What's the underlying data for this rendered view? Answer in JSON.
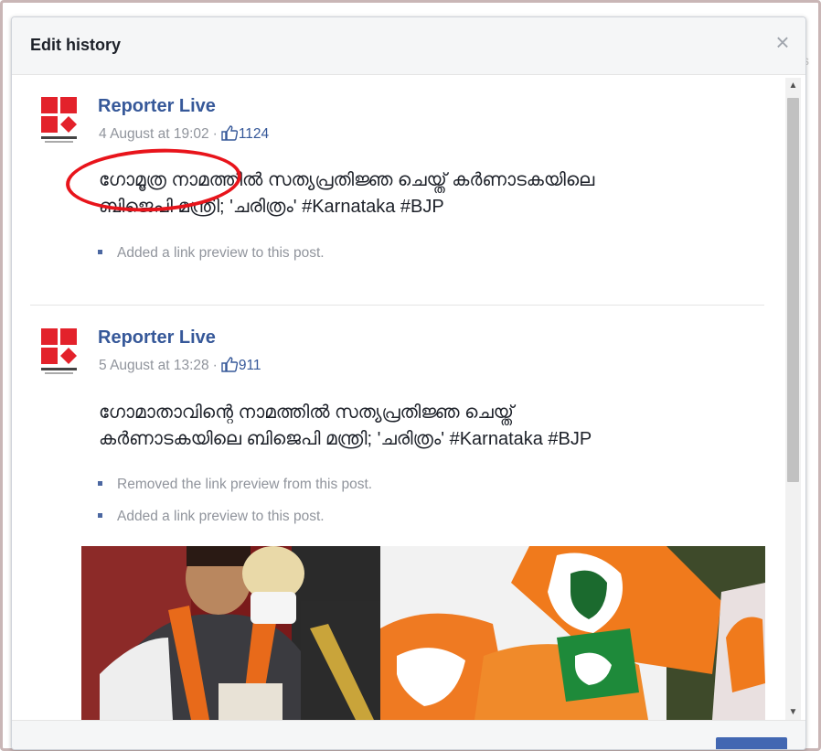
{
  "dialog": {
    "title": "Edit history",
    "close_glyph": "×"
  },
  "entries": [
    {
      "page_name": "Reporter Live",
      "timestamp": "4 August at 19:02",
      "likes": "1124",
      "text_line1": "ഗോമൂത്ര നാമത്തിൽ സത്യപ്രതിജ്ഞ ചെയ്ത് കർണാടകയിലെ",
      "text_line2": "ബിജെപി മന്ത്രി; 'ചരിത്രം' #Karnataka #BJP",
      "changes": [
        "Added a link preview to this post."
      ]
    },
    {
      "page_name": "Reporter Live",
      "timestamp": "5 August at 13:28",
      "likes": "911",
      "text_line1": "ഗോമാതാവിന്റെ നാമത്തിൽ സത്യപ്രതിജ്ഞ ചെയ്ത്",
      "text_line2": "കർണാടകയിലെ ബിജെപി മന്ത്രി; 'ചരിത്രം' #Karnataka #BJP",
      "changes": [
        "Removed the link preview from this post.",
        "Added a link preview to this post."
      ]
    }
  ],
  "icons": {
    "logo": "reporter-logo",
    "like": "thumbs-up-icon",
    "scroll_up": "▲",
    "scroll_down": "▼"
  },
  "colors": {
    "link_blue": "#365899",
    "meta_gray": "#90949c",
    "annotation_red": "#e8141b",
    "logo_red": "#e3222b"
  }
}
